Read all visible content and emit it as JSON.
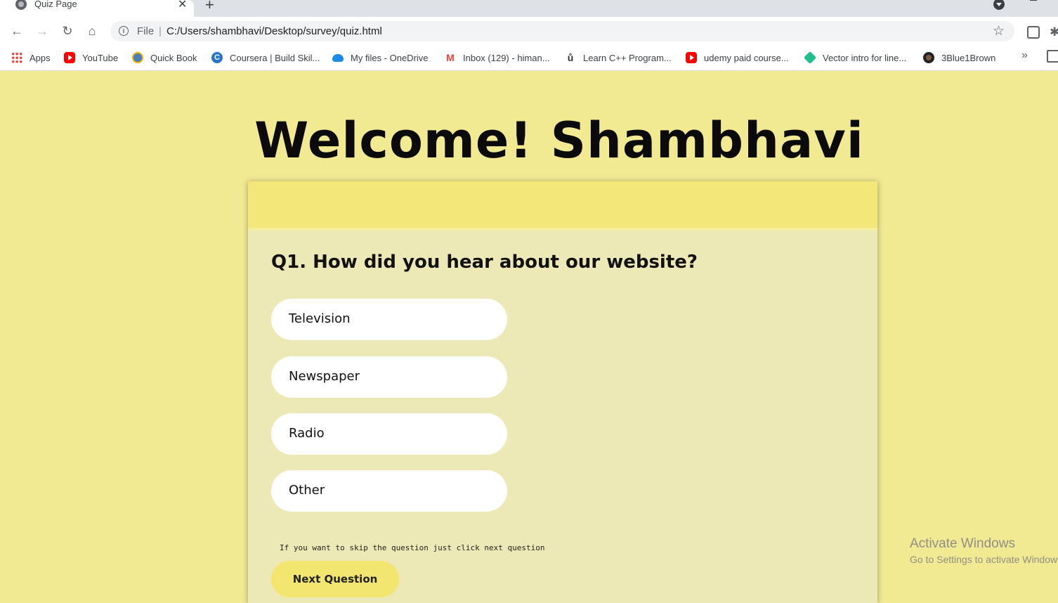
{
  "browser": {
    "tab_title": "Quiz Page",
    "url_scheme": "File",
    "url": "C:/Users/shambhavi/Desktop/survey/quiz.html",
    "bookmarks": [
      {
        "label": "Apps",
        "icon": "apps-grid-icon"
      },
      {
        "label": "YouTube",
        "icon": "youtube-icon"
      },
      {
        "label": "Quick Book",
        "icon": "quickbook-icon"
      },
      {
        "label": "Coursera | Build Skil...",
        "icon": "coursera-icon"
      },
      {
        "label": "My files - OneDrive",
        "icon": "onedrive-icon"
      },
      {
        "label": "Inbox (129) - himan...",
        "icon": "gmail-icon"
      },
      {
        "label": "Learn C++ Program...",
        "icon": "udemy-icon"
      },
      {
        "label": "udemy paid course...",
        "icon": "youtube-icon"
      },
      {
        "label": "Vector intro for line...",
        "icon": "khan-academy-icon"
      },
      {
        "label": "3Blue1Brown",
        "icon": "3blue1brown-icon"
      }
    ],
    "more_bookmarks": "»"
  },
  "page": {
    "welcome": "Welcome! Shambhavi",
    "question": "Q1. How did you hear about our website?",
    "options": [
      "Television",
      "Newspaper",
      "Radio",
      "Other"
    ],
    "hint": "If you want to skip the question just click next question",
    "next_button": "Next Question"
  },
  "watermark": {
    "title": "Activate Windows",
    "subtitle": "Go to Settings to activate Windows."
  },
  "colors": {
    "page_background": "#f2ea92",
    "card_background": "#ede9b6",
    "card_header": "#f2e778",
    "button": "#f2e570"
  }
}
